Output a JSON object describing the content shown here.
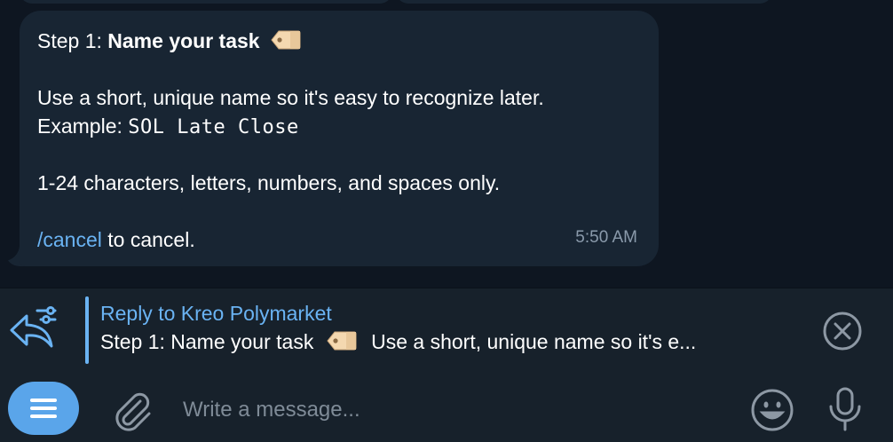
{
  "message": {
    "step_label": "Step 1: ",
    "step_title": "Name your task",
    "line_instruction": "Use a short, unique name so it's easy to recognize later.",
    "example_label": "Example: ",
    "example_value": "SOL Late Close",
    "rules": "1-24 characters, letters, numbers, and spaces only.",
    "cancel_command": "/cancel",
    "cancel_suffix": " to cancel.",
    "time": "5:50 AM"
  },
  "reply": {
    "title": "Reply to Kreo Polymarket",
    "preview_step": "Step 1: Name your task",
    "preview_rest": "Use a short, unique name so it's e..."
  },
  "composer": {
    "placeholder": "Write a message..."
  },
  "colors": {
    "accent": "#6ab3f3",
    "menu_button": "#5aa5ea",
    "bubble": "#182533",
    "background": "#0e1621",
    "panel": "#17212b"
  },
  "icons": {
    "reply": "reply-icon",
    "close": "close-icon",
    "menu": "menu-icon",
    "attach": "paperclip-icon",
    "emoji": "emoji-icon",
    "mic": "microphone-icon",
    "tag": "tag-emoji-icon"
  }
}
